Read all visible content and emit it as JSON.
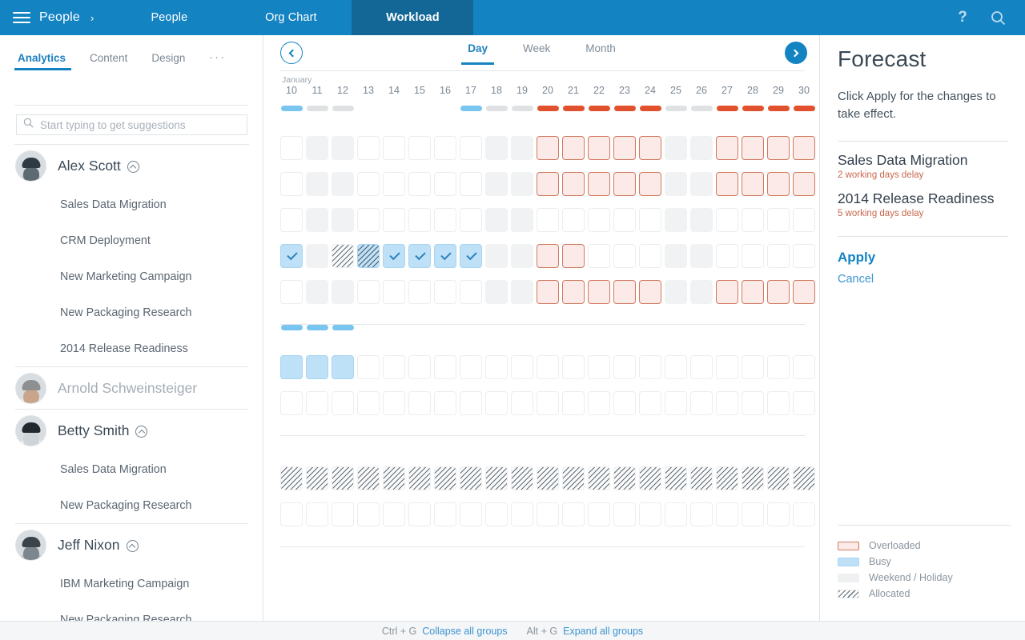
{
  "topnav": {
    "menu_icon": "hamburger-icon",
    "brand": "People",
    "brand_caret": "›",
    "tabs": [
      {
        "label": "People",
        "active": false
      },
      {
        "label": "Org Chart",
        "active": false
      },
      {
        "label": "Workload",
        "active": true
      }
    ],
    "help_icon": "?",
    "search_icon": "search-icon",
    "bg_color": "#1483c2",
    "active_tab_color": "#136796"
  },
  "sidebar": {
    "tabs": [
      {
        "label": "Analytics",
        "active": true
      },
      {
        "label": "Content",
        "active": false
      },
      {
        "label": "Design",
        "active": false
      },
      {
        "label": "...",
        "active": false
      }
    ],
    "search": {
      "placeholder": "Start typing to get suggestions",
      "value": "",
      "icon": "search-icon"
    },
    "people": [
      {
        "name": "Alex Scott",
        "expanded": true,
        "disabled": false,
        "toggle_icon": "chevron-up-circle-icon",
        "projects": [
          "Sales Data Migration",
          "CRM Deployment",
          "New Marketing Campaign",
          "New Packaging Research",
          "2014 Release Readiness"
        ]
      },
      {
        "name": "Arnold Schweinsteiger",
        "expanded": false,
        "disabled": true,
        "toggle_icon": "",
        "projects": []
      },
      {
        "name": "Betty Smith",
        "expanded": true,
        "disabled": false,
        "toggle_icon": "chevron-up-circle-icon",
        "projects": [
          "Sales Data Migration",
          "New Packaging Research"
        ]
      },
      {
        "name": "Jeff Nixon",
        "expanded": true,
        "disabled": false,
        "toggle_icon": "chevron-up-circle-icon",
        "projects": [
          "IBM Marketing Campaign",
          "New Packaging Research"
        ]
      }
    ]
  },
  "timeline": {
    "prev_icon": "chevron-left-circle-icon",
    "next_icon": "chevron-right-circle-icon",
    "scale_tabs": [
      {
        "label": "Day",
        "active": true
      },
      {
        "label": "Week",
        "active": false
      },
      {
        "label": "Month",
        "active": false
      }
    ],
    "month_label": "January",
    "days": [
      10,
      11,
      12,
      13,
      14,
      15,
      16,
      17,
      18,
      19,
      20,
      21,
      22,
      23,
      24,
      25,
      26,
      27,
      28,
      29,
      30
    ],
    "columns": 21,
    "weekend_columns": [
      1,
      2,
      8,
      9,
      15,
      16
    ],
    "sections": [
      {
        "person": "Alex Scott",
        "summary_bar": [
          "busy",
          "free",
          "free",
          "",
          "",
          "",
          "",
          "busy",
          "free",
          "free",
          "over",
          "over",
          "over",
          "over",
          "over",
          "free",
          "free",
          "over",
          "over",
          "over",
          "over"
        ],
        "rows": [
          {
            "project": "Sales Data Migration",
            "cells": [
              "none",
              "weekend",
              "weekend",
              "none",
              "none",
              "none",
              "none",
              "none",
              "weekend",
              "weekend",
              "over",
              "over",
              "over",
              "over",
              "over",
              "weekend",
              "weekend",
              "over",
              "over",
              "over",
              "over"
            ]
          },
          {
            "project": "CRM Deployment",
            "cells": [
              "none",
              "weekend",
              "weekend",
              "none",
              "none",
              "none",
              "none",
              "none",
              "weekend",
              "weekend",
              "over",
              "over",
              "over",
              "over",
              "over",
              "weekend",
              "weekend",
              "over",
              "over",
              "over",
              "over"
            ]
          },
          {
            "project": "New Marketing Campaign",
            "cells": [
              "none",
              "weekend",
              "weekend",
              "none",
              "none",
              "none",
              "none",
              "none",
              "weekend",
              "weekend",
              "none",
              "none",
              "none",
              "none",
              "none",
              "weekend",
              "weekend",
              "none",
              "none",
              "none",
              "none"
            ]
          },
          {
            "project": "New Packaging Research",
            "cells": [
              "busy-chk",
              "weekend",
              "alloc",
              "alloc-busy",
              "busy-chk",
              "busy-chk",
              "busy-chk",
              "busy-chk",
              "weekend",
              "weekend",
              "over",
              "over",
              "none",
              "none",
              "none",
              "weekend",
              "weekend",
              "none",
              "none",
              "none",
              "none"
            ]
          },
          {
            "project": "2014 Release Readiness",
            "cells": [
              "none",
              "weekend",
              "weekend",
              "none",
              "none",
              "none",
              "none",
              "none",
              "weekend",
              "weekend",
              "over",
              "over",
              "over",
              "over",
              "over",
              "weekend",
              "weekend",
              "over",
              "over",
              "over",
              "over"
            ]
          }
        ]
      },
      {
        "person": "Betty Smith",
        "summary_bar": [
          "busy",
          "busy",
          "busy",
          "",
          "",
          "",
          "",
          "",
          "",
          "",
          "",
          "",
          "",
          "",
          "",
          "",
          "",
          "",
          "",
          "",
          ""
        ],
        "rows": [
          {
            "project": "Sales Data Migration",
            "cells": [
              "busy",
              "busy",
              "busy",
              "none",
              "none",
              "none",
              "none",
              "none",
              "none",
              "none",
              "none",
              "none",
              "none",
              "none",
              "none",
              "none",
              "none",
              "none",
              "none",
              "none",
              "none"
            ]
          },
          {
            "project": "New Packaging Research",
            "cells": [
              "none",
              "none",
              "none",
              "none",
              "none",
              "none",
              "none",
              "none",
              "none",
              "none",
              "none",
              "none",
              "none",
              "none",
              "none",
              "none",
              "none",
              "none",
              "none",
              "none",
              "none"
            ]
          }
        ]
      },
      {
        "person": "Jeff Nixon",
        "summary_bar": [],
        "rows": [
          {
            "project": "IBM Marketing Campaign",
            "cells": [
              "alloc",
              "alloc",
              "alloc",
              "alloc",
              "alloc",
              "alloc",
              "alloc",
              "alloc",
              "alloc",
              "alloc",
              "alloc",
              "alloc",
              "alloc",
              "alloc",
              "alloc",
              "alloc",
              "alloc",
              "alloc",
              "alloc",
              "alloc",
              "alloc"
            ]
          },
          {
            "project": "New Packaging Research",
            "cells": [
              "none",
              "none",
              "none",
              "none",
              "none",
              "none",
              "none",
              "none",
              "none",
              "none",
              "none",
              "none",
              "none",
              "none",
              "none",
              "none",
              "none",
              "none",
              "none",
              "none",
              "none"
            ]
          }
        ]
      }
    ]
  },
  "forecast": {
    "title": "Forecast",
    "description": "Click Apply for the changes to take effect.",
    "items": [
      {
        "name": "Sales Data Migration",
        "delay": "2 working days delay"
      },
      {
        "name": "2014 Release Readiness",
        "delay": "5 working days delay"
      }
    ],
    "apply_label": "Apply",
    "cancel_label": "Cancel",
    "legend": [
      {
        "label": "Overloaded",
        "swatch": "overloaded",
        "color": "#fbeae7"
      },
      {
        "label": "Busy",
        "swatch": "busy",
        "color": "#bfe1f7"
      },
      {
        "label": "Weekend / Holiday",
        "swatch": "weekend",
        "color": "#eff0f1"
      },
      {
        "label": "Allocated",
        "swatch": "allocated",
        "color": "#ffffff"
      }
    ]
  },
  "statusbar": {
    "shortcuts": [
      {
        "keys": "Ctrl + G",
        "action": "Collapse all groups"
      },
      {
        "keys": "Alt + G",
        "action": "Expand all groups"
      }
    ]
  }
}
